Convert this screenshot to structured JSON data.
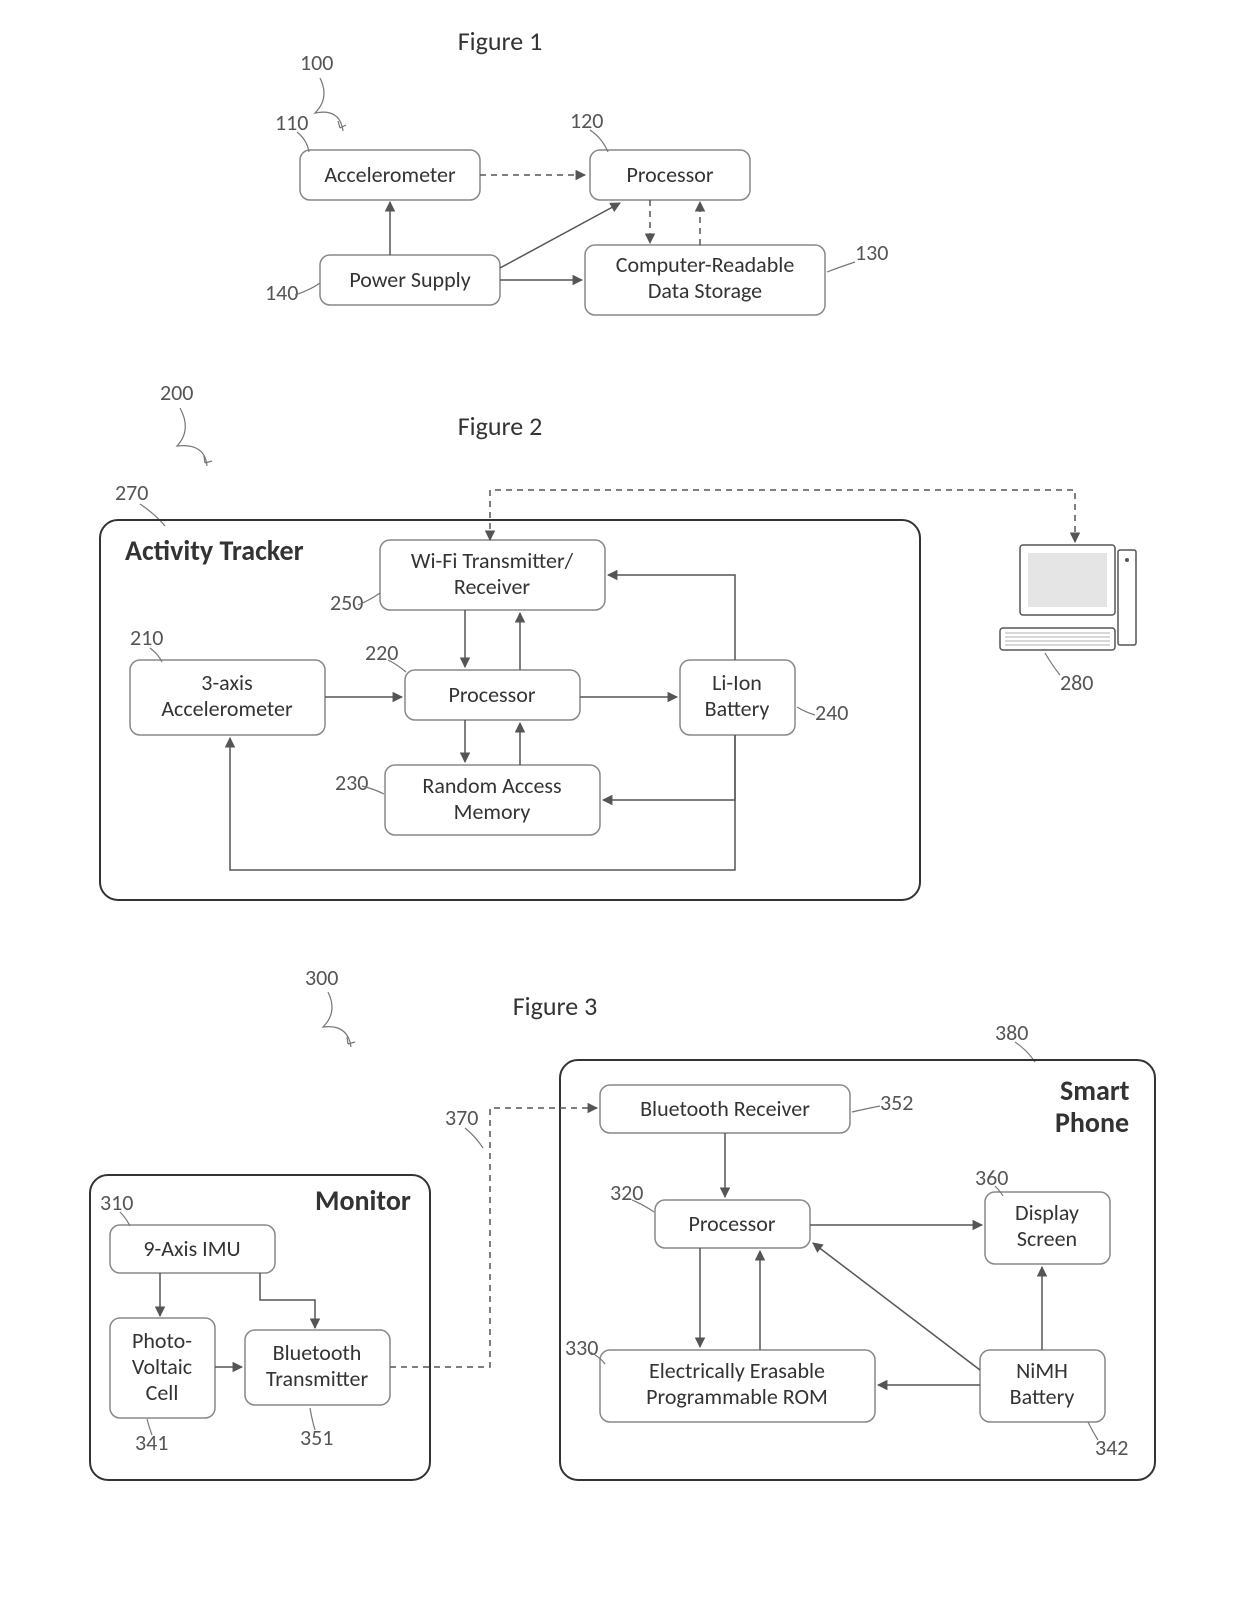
{
  "fig1": {
    "title": "Figure 1",
    "ref": "100",
    "accel": "Accelerometer",
    "accel_ref": "110",
    "proc": "Processor",
    "proc_ref": "120",
    "store1": "Computer-Readable",
    "store2": "Data Storage",
    "store_ref": "130",
    "power": "Power Supply",
    "power_ref": "140"
  },
  "fig2": {
    "title": "Figure 2",
    "ref": "200",
    "container_ref": "270",
    "container_title": "Activity Tracker",
    "wifi1": "Wi-Fi Transmitter/",
    "wifi2": "Receiver",
    "wifi_ref": "250",
    "accel1": "3-axis",
    "accel2": "Accelerometer",
    "accel_ref": "210",
    "proc": "Processor",
    "proc_ref": "220",
    "ram1": "Random Access",
    "ram2": "Memory",
    "ram_ref": "230",
    "batt1": "Li-Ion",
    "batt2": "Battery",
    "batt_ref": "240",
    "computer_ref": "280"
  },
  "fig3": {
    "title": "Figure 3",
    "ref": "300",
    "link_ref": "370",
    "monitor": {
      "title": "Monitor",
      "imu": "9-Axis IMU",
      "imu_ref": "310",
      "pv1": "Photo-",
      "pv2": "Voltaic",
      "pv3": "Cell",
      "pv_ref": "341",
      "bt1": "Bluetooth",
      "bt2": "Transmitter",
      "bt_ref": "351"
    },
    "phone": {
      "title1": "Smart",
      "title2": "Phone",
      "ref": "380",
      "btr": "Bluetooth Receiver",
      "btr_ref": "352",
      "proc": "Processor",
      "proc_ref": "320",
      "eeprom1": "Electrically Erasable",
      "eeprom2": "Programmable ROM",
      "eeprom_ref": "330",
      "disp1": "Display",
      "disp2": "Screen",
      "disp_ref": "360",
      "batt1": "NiMH",
      "batt2": "Battery",
      "batt_ref": "342"
    }
  }
}
